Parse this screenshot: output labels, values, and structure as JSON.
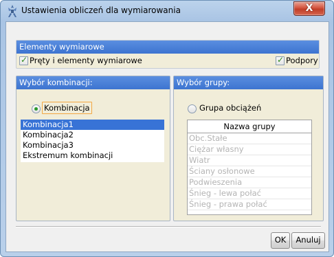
{
  "window": {
    "title": "Ustawienia obliczeń dla wymiarowania",
    "close_label": "X"
  },
  "elements_panel": {
    "header": "Elementy wymiarowe",
    "members_checkbox": {
      "label": "Pręty i elementy wymiarowe",
      "checked": true
    },
    "supports_checkbox": {
      "label": "Podpory",
      "checked": true
    }
  },
  "combination_panel": {
    "header": "Wybór kombinacji:",
    "radio": {
      "label": "Kombinacja",
      "selected": true
    },
    "items": [
      {
        "label": "Kombinacja1",
        "selected": true
      },
      {
        "label": "Kombinacja2",
        "selected": false
      },
      {
        "label": "Kombinacja3",
        "selected": false
      },
      {
        "label": "Ekstremum kombinacji",
        "selected": false
      }
    ]
  },
  "group_panel": {
    "header": "Wybór grupy:",
    "radio": {
      "label": "Grupa obciążeń",
      "selected": false
    },
    "table_header": "Nazwa grupy",
    "rows": [
      "Obc.Stałe",
      "Ciężar własny",
      "Wiatr",
      "Ściany osłonowe",
      "Podwieszenia",
      "Śnieg - lewa połać",
      "Śnieg - prawa połać"
    ]
  },
  "buttons": {
    "ok": "OK",
    "cancel": "Anuluj"
  },
  "colors": {
    "header_blue": "#3d74d0",
    "selection_blue": "#3873d6",
    "panel_beige": "#f1edd9",
    "disabled_text": "#b4b4b4",
    "check_green": "#2f8a1c"
  }
}
